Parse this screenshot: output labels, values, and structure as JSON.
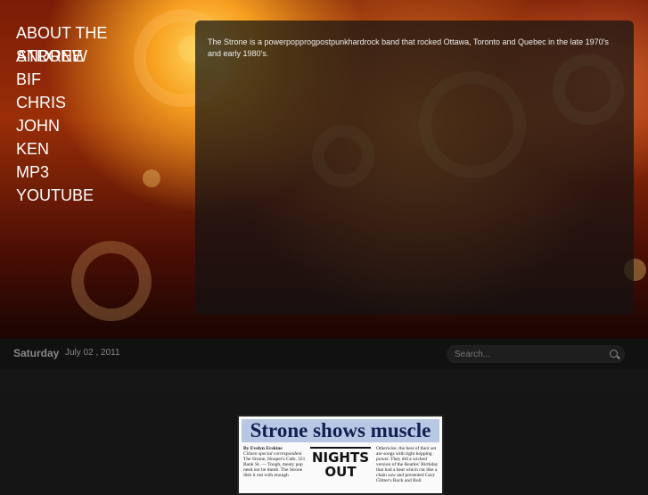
{
  "nav": {
    "items": [
      "ABOUT THE STRONE",
      "ANDREW",
      "BIF",
      "CHRIS",
      "JOHN",
      "KEN",
      "MP3",
      "YOUTUBE"
    ]
  },
  "intro": "The Strone is a powerpopprogpostpunkhardrock band that rocked Ottawa, Toronto and Quebec in the late 1970's and early 1980's.",
  "datebar": {
    "day": "Saturday",
    "date": "July 02 , 2011",
    "search_placeholder": "Search..."
  },
  "clipping": {
    "headline": "Strone shows muscle",
    "byline": "By Evelyn Erskine",
    "byline_sub": "Citizen special correspondent",
    "left_text": "The Strone, Hooper's Cafe, 321 Bank St. — Tough, meaty pop need not be dumb. The Strone dish it out with enough",
    "masthead": "NIGHTS OUT",
    "right_text": "Otherwise, the best of their set are songs with tight hopping power. They did a wicked version of the Beatles' Birthday that had a beat which cut like a chain saw and presented Gary Glitter's Rock and Roll"
  }
}
